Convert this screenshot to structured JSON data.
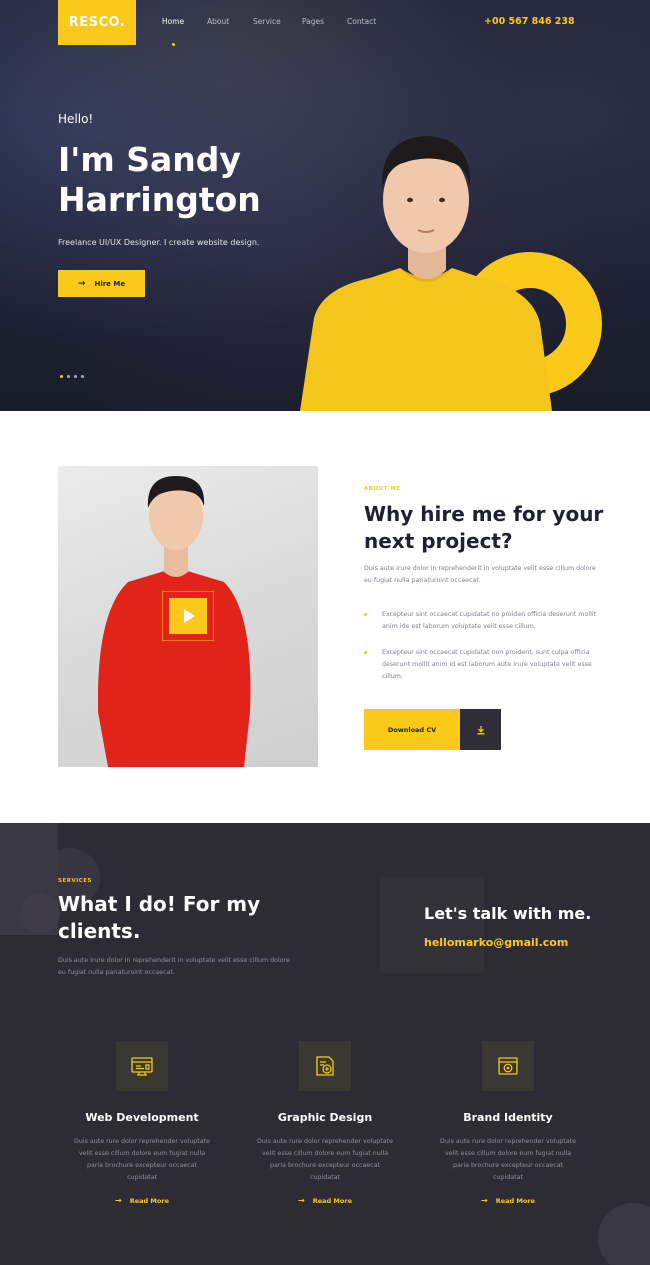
{
  "header": {
    "logo": "RESCO.",
    "nav": [
      "Home",
      "About",
      "Service",
      "Pages",
      "Contact"
    ],
    "phone": "+00 567 846 238"
  },
  "hero": {
    "greeting": "Hello!",
    "name": "I'm Sandy Harrington",
    "subtitle": "Freelance UI/UX Designer. I create website design.",
    "cta": "Hire Me"
  },
  "about": {
    "eyebrow": "ABOUT ME",
    "title": "Why hire me for your next project?",
    "description": "Duis aute irure dolor in reprehenderit in voluptate velit esse cillum dolore eu fugiat nulla pariaturoint occaecat.",
    "bullets": [
      "Excepteur sint occaecat cupidatat no proiden officia deserunt mollit anim ide est laborum voluptate velit esse cillum.",
      "Excepteur sint occaecat cupidatat non proident, sunt culpa officia deserunt mollit anim id est laborum aute irure voluptate velit esse cillum."
    ],
    "cv_button": "Download CV"
  },
  "services": {
    "eyebrow": "SERVICES",
    "title": "What I do! For my clients.",
    "description": "Duis aute irure dolor in reprehenderit in voluptate velit esse cillum dolore eu fugiat nulla pariaturoint occaecat.",
    "talk_title": "Let's talk with me.",
    "email": "hellomarko@gmail.com",
    "cards": [
      {
        "icon": "web-development-icon",
        "title": "Web Development",
        "description": "Duis aute rure dolor reprehender voluptate velit esse cillum dolore eum fugiat nulla paria brochure excepteur occaecat cupidatat",
        "link": "Read More"
      },
      {
        "icon": "graphic-design-icon",
        "title": "Graphic Design",
        "description": "Duis aute rure dolor reprehender voluptate velit esse cillum dolore eum fugiat nulla paria brochure excepteur occaecat cupidatat",
        "link": "Read More"
      },
      {
        "icon": "brand-identity-icon",
        "title": "Brand Identity",
        "description": "Duis aute rure dolor reprehender voluptate velit esse cillum dolore eum fugiat nulla paria brochure excepteur occaecat cupidatat",
        "link": "Read More"
      }
    ]
  },
  "colors": {
    "accent": "#fbc919",
    "dark": "#2d2c35",
    "hero": "#22263a",
    "text_dark": "#1f2030"
  }
}
